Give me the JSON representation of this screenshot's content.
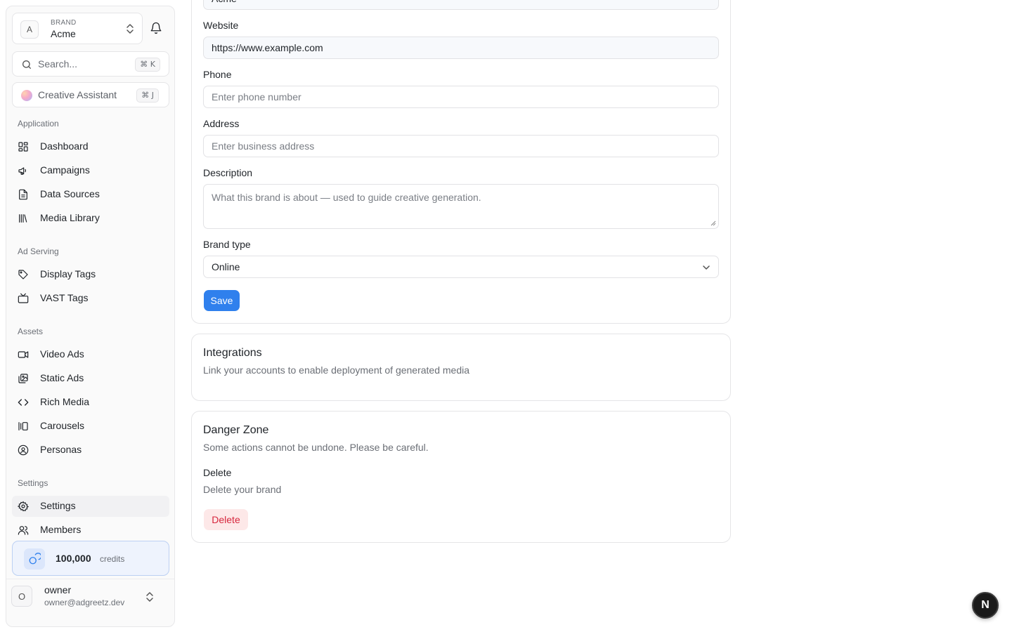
{
  "sidebar": {
    "brand": {
      "kicker": "BRAND",
      "name": "Acme",
      "initial": "A"
    },
    "search": {
      "label": "Search...",
      "shortcut": "⌘ K"
    },
    "assistant": {
      "label": "Creative Assistant",
      "shortcut": "⌘ J"
    },
    "sections": {
      "application": "Application",
      "ad_serving": "Ad Serving",
      "assets": "Assets",
      "settings": "Settings"
    },
    "items": {
      "dashboard": "Dashboard",
      "campaigns": "Campaigns",
      "data_sources": "Data Sources",
      "media_library": "Media Library",
      "display_tags": "Display Tags",
      "vast_tags": "VAST Tags",
      "video_ads": "Video Ads",
      "static_ads": "Static Ads",
      "rich_media": "Rich Media",
      "carousels": "Carousels",
      "personas": "Personas",
      "settings": "Settings",
      "members": "Members"
    },
    "active_item": "settings",
    "credits": {
      "value": "100,000",
      "unit": "credits"
    },
    "user": {
      "initial": "O",
      "name": "owner",
      "email": "owner@adgreetz.dev"
    }
  },
  "form": {
    "name_value_partial": "Acme",
    "website": {
      "label": "Website",
      "value": "https://www.example.com"
    },
    "phone": {
      "label": "Phone",
      "placeholder": "Enter phone number"
    },
    "address": {
      "label": "Address",
      "placeholder": "Enter business address"
    },
    "description": {
      "label": "Description",
      "placeholder": "What this brand is about — used to guide creative generation."
    },
    "brand_type": {
      "label": "Brand type",
      "value": "Online"
    },
    "save_label": "Save"
  },
  "integrations": {
    "title": "Integrations",
    "subtitle": "Link your accounts to enable deployment of generated media"
  },
  "danger_zone": {
    "title": "Danger Zone",
    "subtitle": "Some actions cannot be undone. Please be careful.",
    "delete_heading": "Delete",
    "delete_description": "Delete your brand",
    "delete_label": "Delete"
  },
  "fab": {
    "label": "N"
  },
  "colors": {
    "accent": "#2f80ed",
    "danger": "#d7263d",
    "danger_bg": "#fde8e8",
    "credits_bg": "#eef3fd"
  }
}
